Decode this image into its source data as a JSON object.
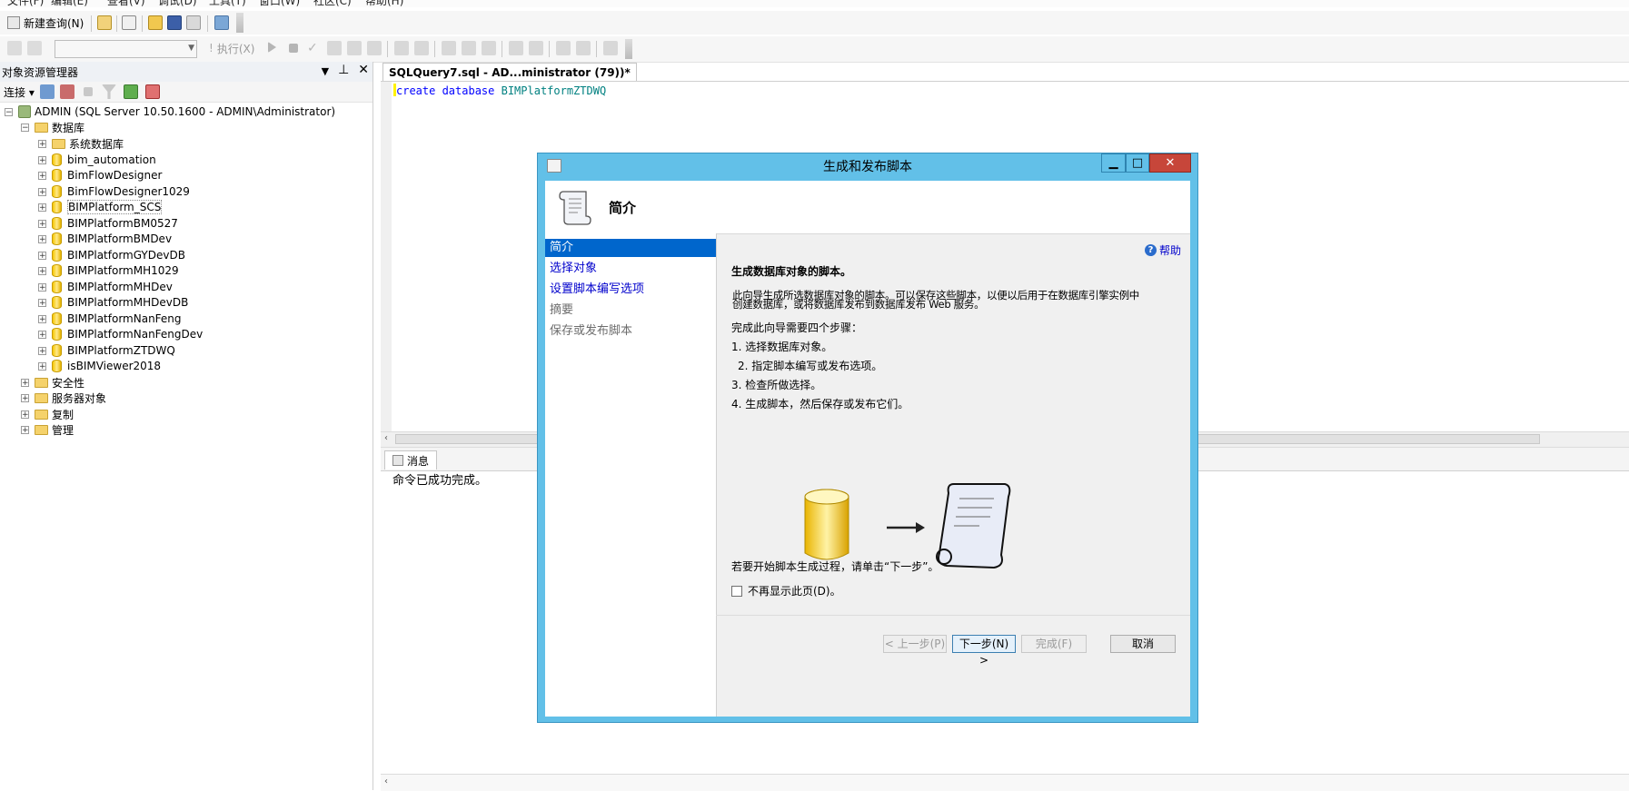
{
  "menu": [
    "文件(F)",
    "编辑(E)",
    "查看(V)",
    "调试(D)",
    "工具(T)",
    "窗口(W)",
    "社区(C)",
    "帮助(H)"
  ],
  "toolbar": {
    "new_query": "新建查询(N)",
    "execute": "执行(X)"
  },
  "object_explorer": {
    "title": "对象资源管理器",
    "connect": "连接",
    "server": "ADMIN (SQL Server 10.50.1600 - ADMIN\\Administrator)",
    "databases_folder": "数据库",
    "system_databases": "系统数据库",
    "databases": [
      "bim_automation",
      "BimFlowDesigner",
      "BimFlowDesigner1029",
      "BIMPlatform_SCS",
      "BIMPlatformBM0527",
      "BIMPlatformBMDev",
      "BIMPlatformGYDevDB",
      "BIMPlatformMH1029",
      "BIMPlatformMHDev",
      "BIMPlatformMHDevDB",
      "BIMPlatformNanFeng",
      "BIMPlatformNanFengDev",
      "BIMPlatformZTDWQ",
      "isBIMViewer2018"
    ],
    "top_folders": [
      "安全性",
      "服务器对象",
      "复制",
      "管理"
    ]
  },
  "editor": {
    "tab_title": "SQLQuery7.sql - AD...ministrator (79))*",
    "code_kw": "create database",
    "code_ident": "BIMPlatformZTDWQ"
  },
  "results": {
    "tab": "消息",
    "message": "命令已成功完成。"
  },
  "dialog": {
    "title": "生成和发布脚本",
    "header_title": "简介",
    "help": "帮助",
    "nav": [
      "简介",
      "选择对象",
      "设置脚本编写选项",
      "摘要",
      "保存或发布脚本"
    ],
    "heading": "生成数据库对象的脚本。",
    "desc_line1": "此向导生成所选数据库对象的脚本。可以保存这些脚本，以便以后用于在数据库引擎实例中",
    "desc_line2": "创建数据库，或将数据库发布到数据库发布 Web 服务。",
    "steps_intro": "完成此向导需要四个步骤：",
    "steps": [
      "1. 选择数据库对象。",
      "2. 指定脚本编写或发布选项。",
      "3. 检查所做选择。",
      "4. 生成脚本，然后保存或发布它们。"
    ],
    "start_hint": "若要开始脚本生成过程，请单击“下一步”。",
    "checkbox_label": "不再显示此页(D)。",
    "buttons": {
      "prev": "< 上一步(P)",
      "next": "下一步(N) >",
      "finish": "完成(F)",
      "cancel": "取消"
    }
  }
}
